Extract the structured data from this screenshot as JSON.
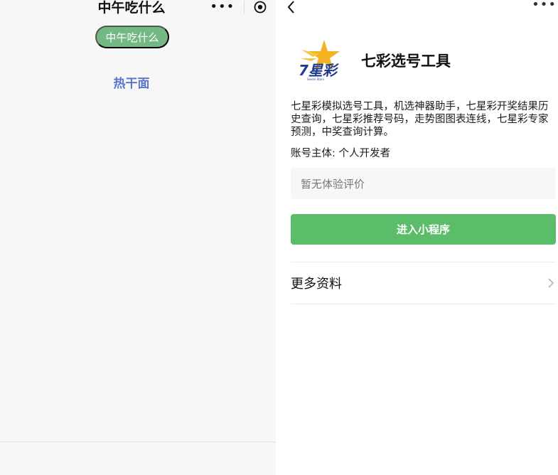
{
  "left_panel": {
    "title": "中午吃什么",
    "capsule_more": "•••",
    "pill_label": "中午吃什么",
    "result_text": "热干面"
  },
  "right_panel": {
    "more": "•••",
    "logo_text": "7星彩",
    "logo_subtext": "Seven Stars",
    "app_name": "七彩选号工具",
    "description": "七星彩模拟选号工具，机选神器助手，七星彩开奖结果历史查询，七星彩推荐号码，走势图图表连线，七星彩专家预测，中奖查询计算。",
    "account": "账号主体: 个人开发者",
    "review_placeholder": "暂无体验评价",
    "enter_button": "进入小程序",
    "more_info": "更多资料"
  },
  "colors": {
    "pill_green": "#74b883",
    "button_green": "#5bbd6a",
    "link_blue": "#5877c9"
  },
  "icons": [
    "target-icon",
    "back-chevron-icon",
    "more-dots-icon",
    "chevron-right-icon"
  ]
}
